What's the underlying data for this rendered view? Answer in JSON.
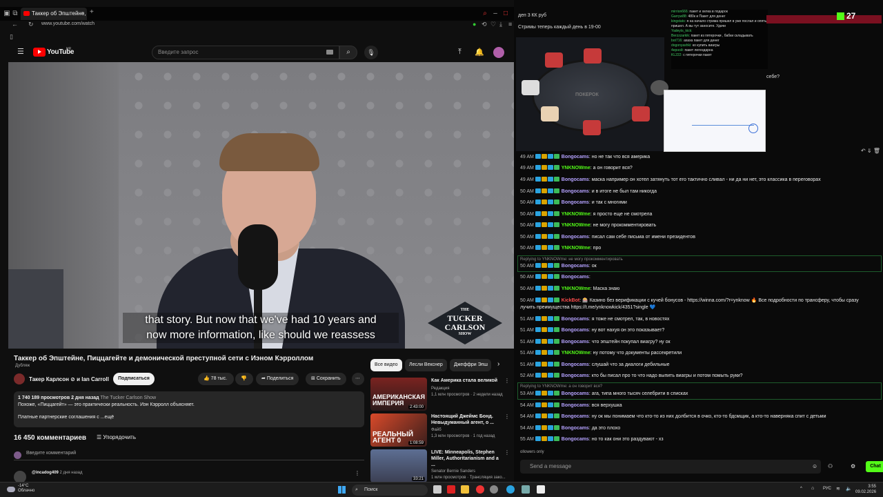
{
  "browser": {
    "tab_title": "Таккер об Эпштейне,",
    "url": "www.youtube.com/watch"
  },
  "youtube": {
    "logo_text": "YouTube",
    "logo_sup": "HR",
    "search_placeholder": "Введите запрос",
    "video": {
      "caption_line1": "that story. But now that we've had 10 years and",
      "caption_line2": "now more information, like should we reassess",
      "watermark_1": "THE",
      "watermark_2": "TUCKER",
      "watermark_3": "CARLSON",
      "watermark_4": "SHOW"
    },
    "title": "Таккер об Эпштейне, Пиццагейте и демонической преступной сети с Иэном Кэрроллом",
    "dub_label": "Дубляж",
    "channel": "Такер Карлсон ⊘ и Ian Carroll",
    "subscribe": "Подписаться",
    "likes": "78 тыс.",
    "share": "Поделиться",
    "save": "Сохранить",
    "description": {
      "stats": "1 740 189 просмотров  2 дня назад",
      "source": "The Tucker Carlson Show",
      "line2": "Похоже, «Пиццагейт» — это практически реальность. Иэн Кэрролл объясняет.",
      "line3": "Платные партнерские соглашения с",
      "more": "...ещё"
    },
    "comments_count": "16 450 комментариев",
    "sort_label": "Упорядочить",
    "comment_placeholder": "Введите комментарий",
    "first_comment_user": "@incadog409",
    "first_comment_time": "2 дня назад",
    "chips": [
      "Все видео",
      "Лесли Векснер",
      "Джеффри Эпш"
    ],
    "recommendations": [
      {
        "title": "Как Америка стала великой",
        "channel": "Редакция",
        "meta": "1,1 млн просмотров · 2 недели назад",
        "thumb_text": "АМЕРИКАНСКАЯ ИМПЕРИЯ",
        "duration": "2:43:00"
      },
      {
        "title": "Настоящий Джеймс Бонд. Невыдуманный агент, о ...",
        "channel": "Файб",
        "meta": "1,3 млн просмотров · 1 год назад",
        "thumb_text": "РЕАЛЬНЫЙ АГЕНТ 0",
        "duration": "1:08:59"
      },
      {
        "title": "LIVE: Minneapolis, Stephen Miller, Authoritarianism and a ...",
        "channel": "Senator Bernie Sanders",
        "meta": "1 млн просмотров · Трансляция зако...",
        "thumb_text": "",
        "duration": "33:21"
      }
    ]
  },
  "stream": {
    "top_line1": "деп 3 КК руб",
    "top_line2": "Стримы теперь каждый день в 19-00",
    "viewer_count": "27",
    "poker_logo": "ПОКЕРОК",
    "overlay_chat": [
      {
        "user": "mirrion666:",
        "text": "пакет и хелка в подарок"
      },
      {
        "user": "Garryw88:",
        "text": "480к и Пакет для денег"
      },
      {
        "user": "kingstats:",
        "text": "я на начало стрима пришел в уже послал и опять пришел. А вы тут заносите. Удачи"
      },
      {
        "user": "Yadeyts_kick:",
        "text": ""
      },
      {
        "user": "Berzzzarkik:",
        "text": "пакет из пятерочки , бабки складывать"
      },
      {
        "user": "bot716:",
        "text": "ахаха пакет для денег"
      },
      {
        "user": "dogonyashki:",
        "text": "ко купить виагры"
      },
      {
        "user": "4ерной:",
        "text": "пакет легендарна"
      },
      {
        "user": "KL222:",
        "text": "с пятерочки пакет"
      }
    ],
    "side_question": "себе?",
    "chat": [
      {
        "time": "49 AM",
        "user": "Bongocams",
        "color": "#b5a2ff",
        "text": ": но не так что вся америка"
      },
      {
        "time": "49 AM",
        "user": "YNKNOWme",
        "color": "#53fc18",
        "text": ": а он говорит вся?"
      },
      {
        "time": "49 AM",
        "user": "Bongocams",
        "color": "#b5a2ff",
        "text": ": маска например он хотел затянуть тот его тактично сливал - ни да ни нет, это классика в переговорах"
      },
      {
        "time": "50 AM",
        "user": "Bongocams",
        "color": "#b5a2ff",
        "text": ": и в итоге не был там никогда"
      },
      {
        "time": "50 AM",
        "user": "Bongocams",
        "color": "#b5a2ff",
        "text": ": и так с многими"
      },
      {
        "time": "50 AM",
        "user": "YNKNOWme",
        "color": "#53fc18",
        "text": ": я просто еще не смотрела"
      },
      {
        "time": "50 AM",
        "user": "YNKNOWme",
        "color": "#53fc18",
        "text": ": не могу прокомментировать"
      },
      {
        "time": "50 AM",
        "user": "Bongocams",
        "color": "#b5a2ff",
        "text": ": писал сам себе письма от имени президентов"
      },
      {
        "time": "50 AM",
        "user": "YNKNOWme",
        "color": "#53fc18",
        "text": ": про"
      },
      {
        "time": "50 AM",
        "user": "Bongocams",
        "color": "#b5a2ff",
        "text": ": ок"
      },
      {
        "time": "50 AM",
        "user": "Bongocams",
        "color": "#b5a2ff",
        "text": ":"
      },
      {
        "time": "50 AM",
        "user": "YNKNOWme",
        "color": "#53fc18",
        "text": ": Маска знаю"
      },
      {
        "time": "50 AM",
        "user": "KickBot",
        "color": "#ff4d4d",
        "text": ": 🎰 Казино без верификации с кучей бонусов - https://winna.com/?r=ynknow 🔥 Все подробности по трансферу, чтобы сразу"
      },
      {
        "time": "",
        "user": "",
        "color": "#eee",
        "text": "лучить преимущества https://t.me/ynknowkick/4351?single 💙"
      },
      {
        "time": "51 AM",
        "user": "Bongocams",
        "color": "#b5a2ff",
        "text": ": я тоже не смотрел, так, в новостях"
      },
      {
        "time": "51 AM",
        "user": "Bongocams",
        "color": "#b5a2ff",
        "text": ": ну вот нахуя он это показывает?"
      },
      {
        "time": "51 AM",
        "user": "Bongocams",
        "color": "#b5a2ff",
        "text": ": что эпштейн покупал виагру? ну ок"
      },
      {
        "time": "51 AM",
        "user": "YNKNOWme",
        "color": "#53fc18",
        "text": ": ну потому что документы рассекретили"
      },
      {
        "time": "51 AM",
        "user": "Bongocams",
        "color": "#b5a2ff",
        "text": ": слушай что за диалоги дебильные"
      },
      {
        "time": "52 AM",
        "user": "Bongocams",
        "color": "#b5a2ff",
        "text": ": кто бы писал про то что надо выпить виагры и потом помыть руки?"
      },
      {
        "time": "53 AM",
        "user": "Bongocams",
        "color": "#b5a2ff",
        "text": ": ага, типа много тысяч селебрити в списках"
      },
      {
        "time": "54 AM",
        "user": "Bongocams",
        "color": "#b5a2ff",
        "text": ": вся верхушка"
      },
      {
        "time": "54 AM",
        "user": "Bongocams",
        "color": "#b5a2ff",
        "text": ": ну ок мы понимаем что кто-то из них долбится в очко, кто-то бдсмщик, а кто-то наверняка спит с детьми"
      },
      {
        "time": "54 AM",
        "user": "Bongocams",
        "color": "#b5a2ff",
        "text": ": да это плохо"
      },
      {
        "time": "55 AM",
        "user": "Bongocams",
        "color": "#b5a2ff",
        "text": ": но то как они это раздувают - хз"
      }
    ],
    "reply_1": "Replying to YNKNOWme: не могу прокомментировать",
    "reply_2": "Replying to YNKNOWme: а он говорит вся?",
    "followers_only": "ollowers only",
    "send_placeholder": "Send a message",
    "chat_button": "Chat"
  },
  "taskbar": {
    "temp": "-14°C",
    "weather": "Облачно",
    "search": "Поиск",
    "lang": "РУС",
    "time": "3:55",
    "date": "09.02.2026"
  }
}
